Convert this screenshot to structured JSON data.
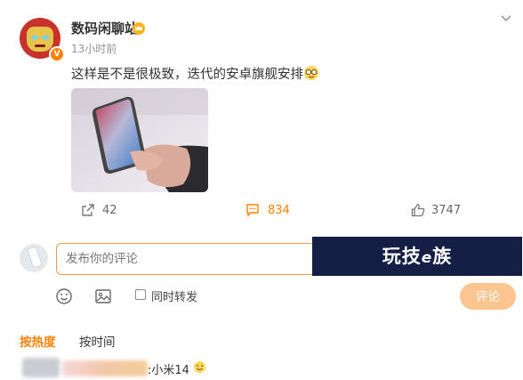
{
  "post": {
    "username": "数码闲聊站",
    "time": "13小时前",
    "text": "这样是不是很极致，迭代的安卓旗舰安排！"
  },
  "actions": {
    "repost_count": "42",
    "comment_count": "834",
    "like_count": "3747"
  },
  "comment_box": {
    "placeholder": "发布你的评论",
    "repost_label": "同时转发",
    "submit_label": "评论"
  },
  "banner": {
    "text_before": "玩技",
    "text_e": "e",
    "text_after": "族"
  },
  "sort": {
    "hot": "按热度",
    "time": "按时间"
  },
  "first_comment": {
    "text": ":小米14"
  },
  "colors": {
    "accent": "#ff8200",
    "submit": "#fbc58f",
    "banner_bg": "#151f46"
  },
  "icons": {
    "repost": "share-icon",
    "comment": "comment-icon",
    "like": "thumbs-up-icon",
    "emoji": "emoji-icon",
    "image": "image-icon",
    "more": "chevron-down-icon"
  }
}
